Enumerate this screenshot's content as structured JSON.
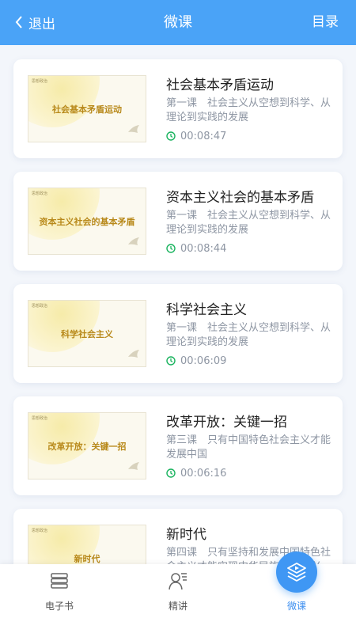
{
  "header": {
    "back_label": "退出",
    "title": "微课",
    "menu_label": "目录"
  },
  "colors": {
    "primary": "#4aa3f7",
    "accent": "#3d8ff0",
    "clock": "#19b35e",
    "thumb_text": "#b8891a"
  },
  "lessons": [
    {
      "thumb_caption": "社会基本矛盾运动",
      "title": "社会基本矛盾运动",
      "subtitle": "第一课　社会主义从空想到科学、从理论到实践的发展",
      "duration": "00:08:47"
    },
    {
      "thumb_caption": "资本主义社会的基本矛盾",
      "title": "资本主义社会的基本矛盾",
      "subtitle": "第一课　社会主义从空想到科学、从理论到实践的发展",
      "duration": "00:08:44"
    },
    {
      "thumb_caption": "科学社会主义",
      "title": "科学社会主义",
      "subtitle": "第一课　社会主义从空想到科学、从理论到实践的发展",
      "duration": "00:06:09"
    },
    {
      "thumb_caption": "改革开放：关键一招",
      "title": "改革开放：关键一招",
      "subtitle": "第三课　只有中国特色社会主义才能发展中国",
      "duration": "00:06:16"
    },
    {
      "thumb_caption": "新时代",
      "title": "新时代",
      "subtitle": "第四课　只有坚持和发展中国特色社会主义才能实现中华民族伟大复兴",
      "duration": ""
    }
  ],
  "tabbar": {
    "items": [
      {
        "label": "电子书",
        "icon": "books-icon"
      },
      {
        "label": "精讲",
        "icon": "lecture-person-icon"
      },
      {
        "label": "微课",
        "icon": "layers-play-icon"
      }
    ],
    "active": "微课"
  }
}
